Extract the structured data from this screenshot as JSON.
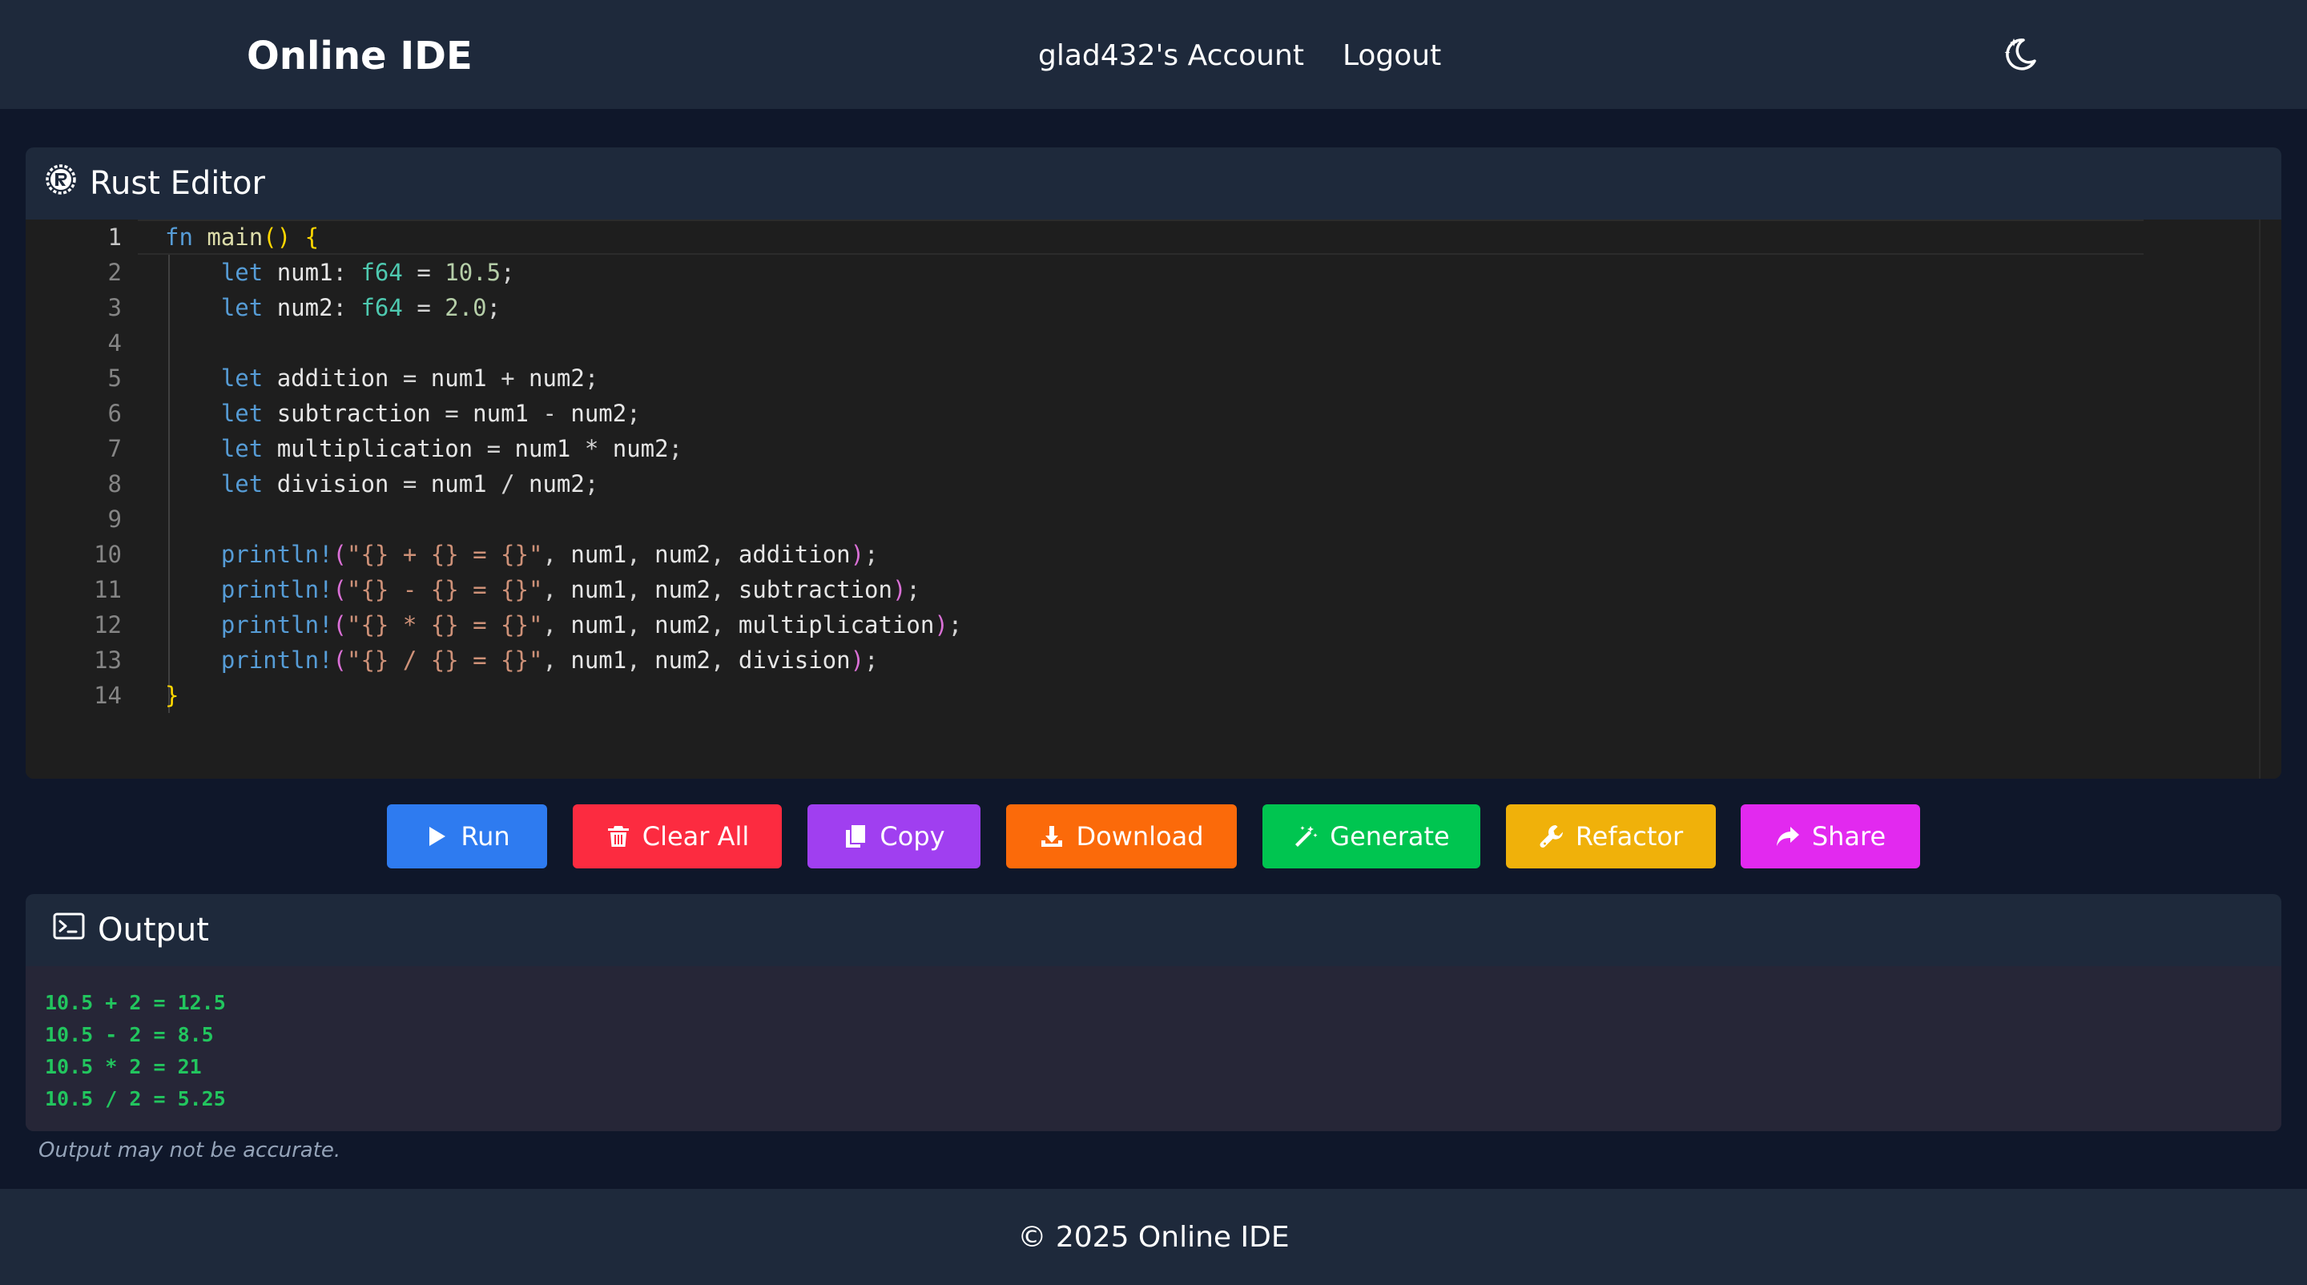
{
  "header": {
    "brand": "Online IDE",
    "nav": [
      {
        "label": "glad432's Account"
      },
      {
        "label": "Logout"
      }
    ],
    "theme_icon": "moon-stars-icon"
  },
  "editor": {
    "title": "Rust Editor",
    "title_icon": "rust-logo-icon",
    "line_numbers": [
      "1",
      "2",
      "3",
      "4",
      "5",
      "6",
      "7",
      "8",
      "9",
      "10",
      "11",
      "12",
      "13",
      "14"
    ],
    "code_lines": [
      "fn main() {",
      "    let num1: f64 = 10.5;",
      "    let num2: f64 = 2.0;",
      "",
      "    let addition = num1 + num2;",
      "    let subtraction = num1 - num2;",
      "    let multiplication = num1 * num2;",
      "    let division = num1 / num2;",
      "",
      "    println!(\"{} + {} = {}\", num1, num2, addition);",
      "    println!(\"{} - {} = {}\", num1, num2, subtraction);",
      "    println!(\"{} * {} = {}\", num1, num2, multiplication);",
      "    println!(\"{} / {} = {}\", num1, num2, division);",
      "}"
    ],
    "active_line": 1
  },
  "toolbar": {
    "run": "Run",
    "clear": "Clear All",
    "copy": "Copy",
    "download": "Download",
    "generate": "Generate",
    "refactor": "Refactor",
    "share": "Share"
  },
  "colors": {
    "run": "#2e7bf0",
    "clear": "#fc2b40",
    "copy": "#a03ff0",
    "download": "#fb6a0a",
    "generate": "#00c550",
    "refactor": "#f0b10a",
    "share": "#e229ef",
    "output_text": "#22c55e"
  },
  "output": {
    "title": "Output",
    "title_icon": "terminal-icon",
    "lines": [
      "10.5 + 2 = 12.5",
      "10.5 - 2 = 8.5",
      "10.5 * 2 = 21",
      "10.5 / 2 = 5.25"
    ],
    "disclaimer": "Output may not be accurate."
  },
  "footer": {
    "text": "© 2025 Online IDE"
  }
}
